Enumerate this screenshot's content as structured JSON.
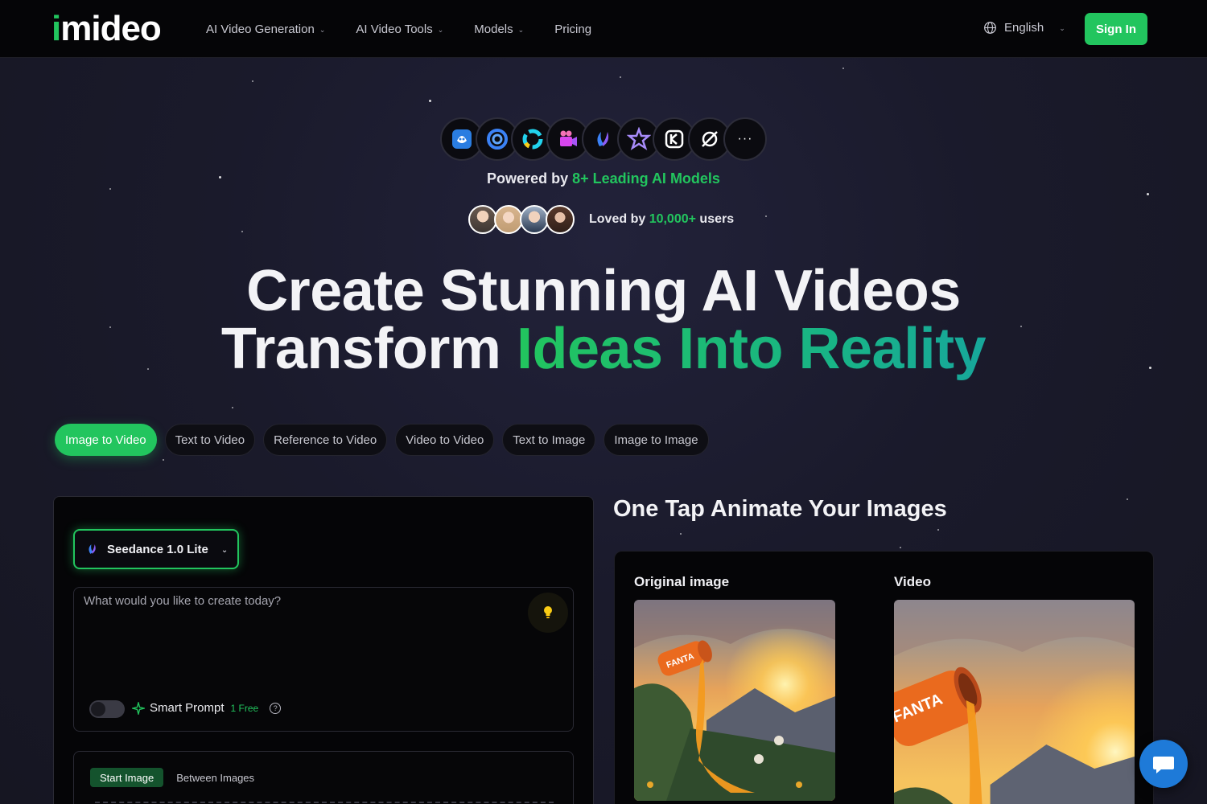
{
  "nav": {
    "logo": "imideo",
    "links": [
      {
        "label": "AI Video Generation",
        "dropdown": true
      },
      {
        "label": "AI Video Tools",
        "dropdown": true
      },
      {
        "label": "Models",
        "dropdown": true
      },
      {
        "label": "Pricing",
        "dropdown": false
      }
    ],
    "language": "English",
    "signin": "Sign In"
  },
  "models_strip": {
    "icons": [
      "hailuo-icon",
      "pollo-icon",
      "runway-icon",
      "pika-icon",
      "seedance-icon",
      "vidu-icon",
      "kling-icon",
      "luma-icon",
      "more-icon"
    ],
    "more_glyph": "···"
  },
  "powered": {
    "prefix": "Powered by ",
    "highlight": "8+ Leading AI Models"
  },
  "loved": {
    "prefix": "Loved by ",
    "highlight": "10,000+",
    "suffix": " users"
  },
  "hero": {
    "line1": "Create Stunning AI Videos",
    "line2_plain": "Transform ",
    "line2_highlight": "Ideas Into Reality"
  },
  "tabs": [
    {
      "label": "Image to Video",
      "active": true
    },
    {
      "label": "Text to Video",
      "active": false
    },
    {
      "label": "Reference to Video",
      "active": false
    },
    {
      "label": "Video to Video",
      "active": false
    },
    {
      "label": "Text to Image",
      "active": false
    },
    {
      "label": "Image to Image",
      "active": false
    }
  ],
  "generator": {
    "model": "Seedance 1.0 Lite",
    "prompt_placeholder": "What would you like to create today?",
    "prompt_value": "",
    "smart_prompt_label": "Smart Prompt",
    "smart_prompt_badge": "1 Free",
    "smart_prompt_enabled": false,
    "image_modes": [
      {
        "label": "Start Image",
        "active": true
      },
      {
        "label": "Between Images",
        "active": false
      }
    ]
  },
  "showcase": {
    "title": "One Tap Animate Your Images",
    "original_label": "Original image",
    "video_label": "Video",
    "can_text": "FANTA"
  },
  "colors": {
    "accent": "#22c55e",
    "background": "#181826",
    "nav_bg": "#050507",
    "chat": "#1e7ad8"
  }
}
